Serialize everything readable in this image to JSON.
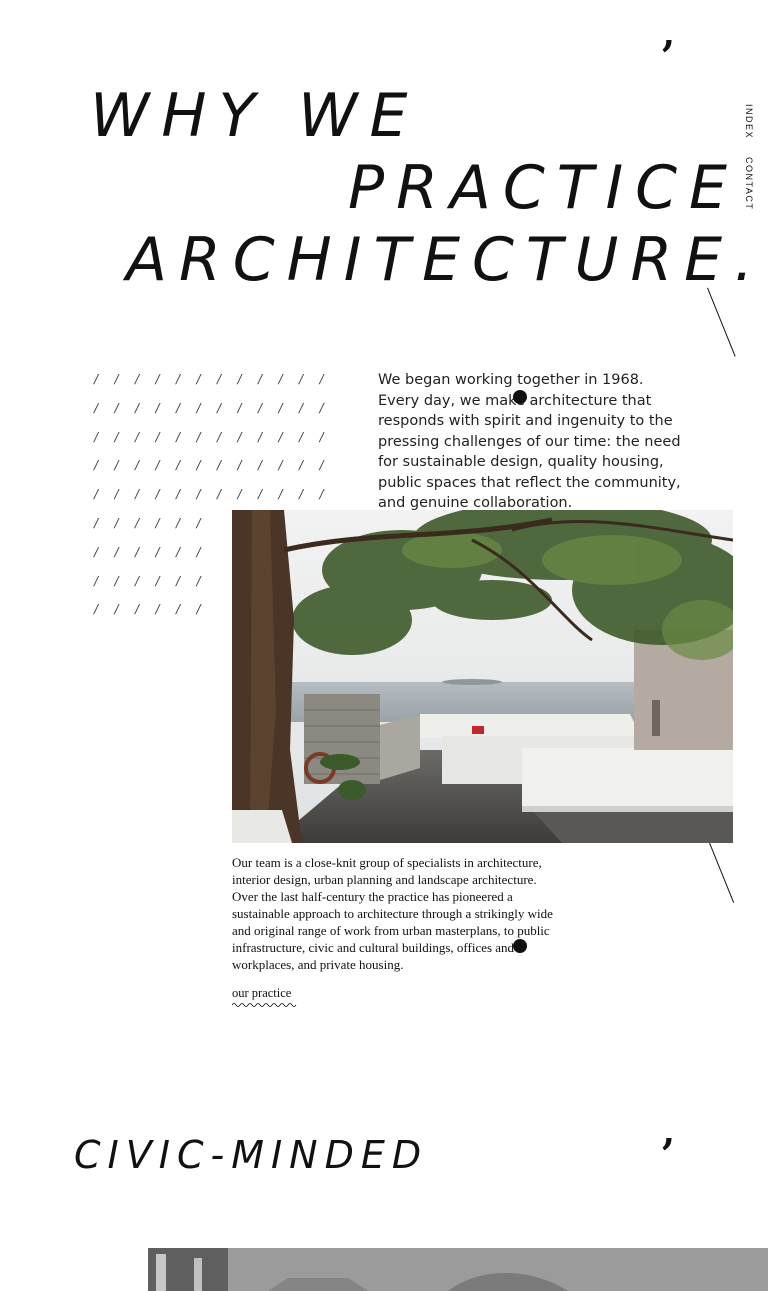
{
  "heading": {
    "line1": "WHY WE",
    "line2": "PRACTICE",
    "line3": "ARCHITECTURE."
  },
  "nav": {
    "index": "INDEX",
    "contact": "CONTACT"
  },
  "intro_text": "We began working together in 1968. Every day, we make architecture that responds with spirit and ingenuity to the pressing challenges of our time: the need for sustainable design, quality housing, public spaces that reflect the community, and genuine collaboration.",
  "body_text": "Our team is a close-knit group of specialists in architecture, interior design, urban planning and landscape architecture. Over the last half-century the practice has pioneered a sustainable approach to architecture through a strikingly wide and original range of work from urban masterplans, to public infrastructure, civic and cultural buildings, offices and workplaces, and private housing.",
  "practice_link": "our practice",
  "section2_heading": "CIVIC-MINDED",
  "comma_glyph": ",",
  "slash_glyph": "/",
  "colors": {
    "text": "#111111",
    "background": "#ffffff"
  }
}
